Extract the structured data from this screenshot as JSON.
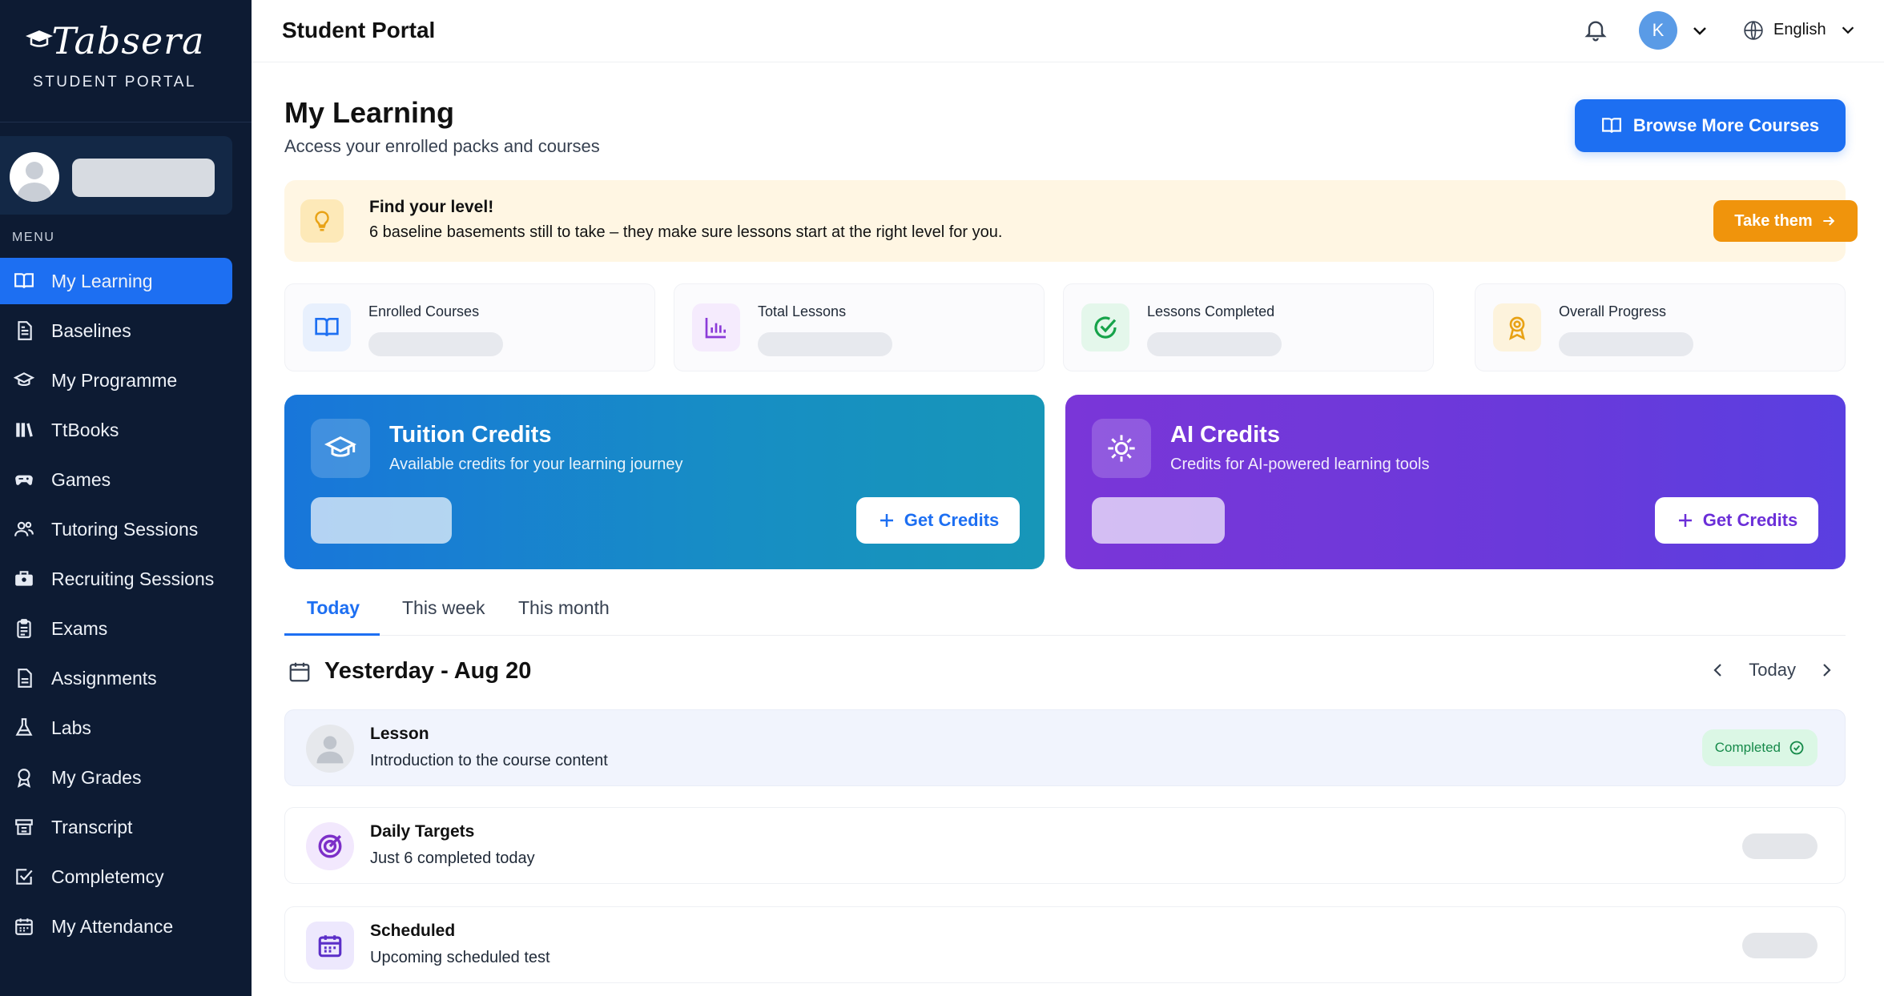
{
  "brand": {
    "name": "Tabsera",
    "subtitle": "STUDENT PORTAL"
  },
  "sidebar": {
    "menu_label": "MENU",
    "items": [
      {
        "label": "My Learning",
        "icon": "book-open-icon",
        "active": true
      },
      {
        "label": "Baselines",
        "icon": "document-icon"
      },
      {
        "label": "My Programme",
        "icon": "graduation-cap-icon"
      },
      {
        "label": "TtBooks",
        "icon": "books-icon"
      },
      {
        "label": "Games",
        "icon": "gamepad-icon"
      },
      {
        "label": "Tutoring Sessions",
        "icon": "users-icon"
      },
      {
        "label": "Recruiting Sessions",
        "icon": "briefcase-icon"
      },
      {
        "label": "Exams",
        "icon": "clipboard-icon"
      },
      {
        "label": "Assignments",
        "icon": "file-text-icon"
      },
      {
        "label": "Labs",
        "icon": "flask-icon"
      },
      {
        "label": "My Grades",
        "icon": "award-icon"
      },
      {
        "label": "Transcript",
        "icon": "transcript-icon"
      },
      {
        "label": "Completemcy",
        "icon": "check-square-icon"
      },
      {
        "label": "My Attendance",
        "icon": "calendar-icon"
      }
    ]
  },
  "header": {
    "title": "Student Portal",
    "user_initial": "K",
    "language": "English"
  },
  "main": {
    "title": "My Learning",
    "subtitle": "Access your enrolled packs and courses",
    "browse_button": "Browse More Courses",
    "banner": {
      "title": "Find your level!",
      "text": "6 baseline basements still to take – they make sure lessons start at the right level for you.",
      "button": "Take them"
    },
    "stats": [
      {
        "label": "Enrolled Courses",
        "icon": "book-open-icon"
      },
      {
        "label": "Total Lessons",
        "icon": "bar-chart-icon"
      },
      {
        "label": "Lessons Completed",
        "icon": "check-circle-icon"
      },
      {
        "label": "Overall Progress",
        "icon": "award-icon"
      }
    ],
    "tuition": {
      "title": "Tuition Credits",
      "subtitle": "Available credits for your learning journey",
      "button": "Get Credits"
    },
    "ai": {
      "title": "AI Credits",
      "subtitle": "Credits for AI-powered learning tools",
      "button": "Get Credits"
    },
    "tabs": [
      "Today",
      "This week",
      "This month"
    ],
    "active_tab": "Today",
    "date_title": "Yesterday - Aug 20",
    "date_nav_label": "Today",
    "events": [
      {
        "title": "Lesson",
        "subtitle": "Introduction to the course content",
        "status": "Completed"
      },
      {
        "title": "Daily Targets",
        "subtitle": "Just 6 completed today"
      },
      {
        "title": "Scheduled",
        "subtitle": "Upcoming scheduled test"
      }
    ]
  },
  "colors": {
    "sidebar_bg": "#0d1b33",
    "accent": "#1d6ff2",
    "banner_bg": "#fff6e3",
    "banner_button": "#f0940c",
    "tuition_gradient_start": "#1876da",
    "ai_gradient_start": "#7a36d8",
    "completed_badge": "#dbf7e5"
  }
}
